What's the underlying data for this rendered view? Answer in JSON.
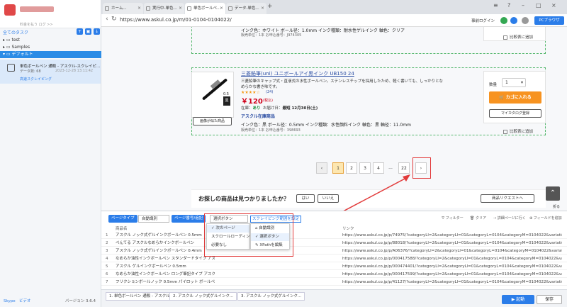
{
  "sidebar": {
    "search_placeholder": "料金を払う ログ >>",
    "heading": "全てのタスク",
    "tree": [
      {
        "label": "test"
      },
      {
        "label": "Samples"
      },
      {
        "label": "デフォルト"
      }
    ],
    "task": {
      "title": "単色ボールペン 通販 - アスクル-スクレイピ...",
      "data_label": "データ数: 68",
      "time": "2023-12-28 13:11:42",
      "kind": "高速スクレイピング"
    },
    "footer": {
      "skype": "Skype",
      "video": "ビデオ",
      "version": "バージョン 3.6.4"
    }
  },
  "tabs": [
    {
      "label": "ホーム..."
    },
    {
      "label": "実行中-単色..."
    },
    {
      "label": "単色ボールペ..."
    },
    {
      "label": "データ-単色..."
    }
  ],
  "address": {
    "url": "https://www.askul.co.jp/m/01-0104-0104022/",
    "login": "事前ログイン",
    "browser": "PCブラウザ"
  },
  "page": {
    "prev_spec": "インク色：ホワイト ボール径：1.0mm インク種類：耐水性ゲルインク 軸色：クリア",
    "prev_meta": "販売単位：1本  お申込番号：J974305",
    "compare": "比較表に追加",
    "product": {
      "title": "三菱鉛筆(uni)  ユニボールアイ黒インク UB150 24",
      "desc": "三菱鉛筆のキャップ式・直液式の水性ボールペン。ステンレスチップを採用したため、軽く書いても、しっかりとなめらかな書き味です。",
      "stars": "★★★★☆",
      "reviews": "(24)",
      "price": "￥120",
      "tax": "(税込)",
      "stock": "在庫：",
      "stock_val": "あり",
      "delivery": "お届け日：",
      "delivery_val": "最短 12月30日(土)",
      "askul": "アスクル在庫商品",
      "spec": "インク色：黒 ボール径：0.5mm インク種類：水性顔料インク 軸色：黒 軸径：11.0mm",
      "meta": "販売単位：1本  お申込番号：398693",
      "pen_size": "0.5",
      "pen_label": "黒",
      "similar_btn": "画像が似た商品",
      "qty_label": "数量",
      "qty_value": "1",
      "cart_btn": "カゴに入れる",
      "mycat_btn": "マイカタログ登録"
    },
    "pager": [
      "1",
      "2",
      "3",
      "4",
      "...",
      "22",
      "›"
    ],
    "notfound": {
      "text": "お探しの商品は見つかりましたか？",
      "yes": "はい",
      "no": "いいえ",
      "request": "商品リクエストへ"
    },
    "collapse": "折る"
  },
  "panel": {
    "page_type_label": "ページタイプ",
    "page_type_value": "自動識別",
    "page_turn_label": "ページ番号/追記",
    "page_turn_value": "選択ボタン",
    "settings_link": "スクレイピング範囲を設定",
    "tools": {
      "filter": "フィルター",
      "clear": "クリア",
      "detail": "詳細ページに行く",
      "add_field": "フィールドを追加"
    },
    "col_name": "商品名",
    "col_link": "リンク",
    "rows": [
      {
        "n": "1",
        "name": "アスクル ノック式ゲルインクボールペン 0.5mm",
        "link": "https://www.askul.co.jp/p/74975/?categoryLl=2&categoryLl=01&categoryL=0104&categoryM=0104022&variationItemLImgPath..."
      },
      {
        "n": "2",
        "name": "ぺんてる アスクルなめらかインクボールペン",
        "link": "https://www.askul.co.jp/p/88018/?categoryLl=2&categoryLl=01&categoryL=0104&categoryM=0104022&variationItemLImgPath..."
      },
      {
        "n": "3",
        "name": "アスクル ノック式ゲルインクボールペン 0.4mm",
        "link": "https://www.askul.co.jp/p/A06376/?categoryLl=2&categoryLl=01&categoryL=0104&categoryM=0104022&variationItemLImgPath..."
      },
      {
        "n": "4",
        "name": "なめらか油性インクボールペン スタンダードタイプ アスクル",
        "link": "https://www.askul.co.jp/p/000417588/?categoryLl=2&categoryLl=01&categoryL=0104&categoryM=0104022&variationItemLImgPath..."
      },
      {
        "n": "5",
        "name": "アスクル ゲルインクボールペン 0.5mm",
        "link": "https://www.askul.co.jp/p/000474401/?categoryLl=2&categoryLl=01&categoryL=0104&categoryM=0104022&variationItemLImgPath..."
      },
      {
        "n": "6",
        "name": "なめらか油性インクボールペン ロング筆記タイプ アスクル",
        "link": "https://www.askul.co.jp/p/000417599/?categoryLl=2&categoryLl=01&categoryL=0104&categoryM=0104022&variationItemLImgPath..."
      },
      {
        "n": "7",
        "name": "フリクションボールノック 0.5mm パイロット ボールペン",
        "link": "https://www.askul.co.jp/p/41127/?categoryLl=2&categoryLl=01&categoryL=0104&categoryM=0104022&variationItemLImgPath..."
      }
    ],
    "dropdown1": [
      "次のページ",
      "スクロールローディング",
      "必要なし"
    ],
    "dropdown2": [
      "自動識別",
      "選択ボタン",
      "XPathを編集"
    ]
  },
  "bottom": {
    "tabs": [
      "1. 単色ボールペン 通販 - アスクル",
      "2. アスクル ノック式ゲルインク...",
      "3. アスクル ノック式ゲルインク..."
    ],
    "start": "▶ 起動",
    "save": "保存"
  }
}
